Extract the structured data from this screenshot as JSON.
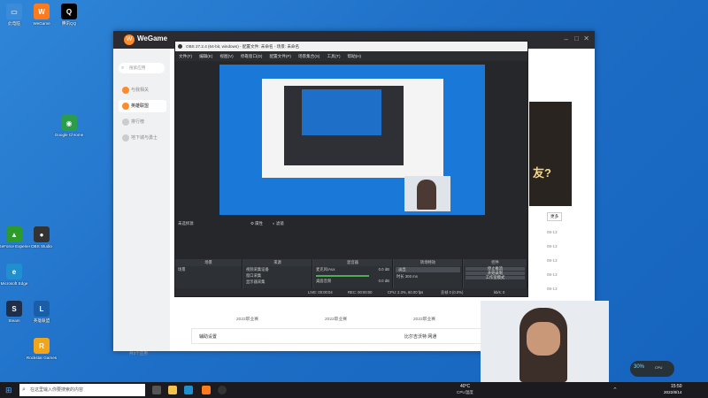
{
  "desktop": {
    "icons": [
      {
        "label": "此电脑",
        "color": "#3b8bd8",
        "glyph": "▭"
      },
      {
        "label": "WeGame",
        "color": "#ff7a1a",
        "glyph": "W"
      },
      {
        "label": "腾讯QQ",
        "color": "#000000",
        "glyph": "Q"
      },
      {
        "label": "Google Chrome",
        "color": "#2a9d4b",
        "glyph": "◉"
      },
      {
        "label": "GeForce Experience",
        "color": "#2c9b2c",
        "glyph": "▲"
      },
      {
        "label": "Microsoft Edge",
        "color": "#1f8fd0",
        "glyph": "e"
      },
      {
        "label": "Steam",
        "color": "#1f2f4a",
        "glyph": "S"
      },
      {
        "label": "英雄联盟",
        "color": "#1a5ea8",
        "glyph": "L"
      },
      {
        "label": "OBS Studio",
        "color": "#333333",
        "glyph": "●"
      },
      {
        "label": "Rockstar Games",
        "color": "#f2a51a",
        "glyph": "R"
      }
    ]
  },
  "wegame": {
    "brand": "WeGame",
    "search_placeholder": "搜索应用",
    "nav": [
      "与我相关",
      "英雄联盟",
      "排行榜",
      "地下城与勇士"
    ],
    "dates": [
      "08-13",
      "08-13",
      "08-13",
      "08-13",
      "08-13"
    ],
    "more": "更多",
    "promo": "友?",
    "bottom_link": "辅助设置",
    "bottom_right": "比尔吉沃特 网通",
    "footer": "共3个应用",
    "match_items": [
      "2022职业赛",
      "2022职业赛",
      "2022职业赛"
    ]
  },
  "obs": {
    "title": "OBS 27.2.4 (64-bit, windows) - 配置文件: 未命名 - 场景: 未命名",
    "menu": [
      "文件(F)",
      "编辑(E)",
      "视图(V)",
      "停靠窗口(D)",
      "配置文件(P)",
      "场景集合(S)",
      "工具(T)",
      "帮助(H)"
    ],
    "scene_label": "未选择源",
    "props_btn": "属性",
    "filters_btn": "滤镜",
    "docks": {
      "scenes": {
        "title": "场景",
        "items": [
          "场景"
        ]
      },
      "sources": {
        "title": "来源",
        "items": [
          "视频采集设备",
          "窗口采集",
          "显示器采集"
        ]
      },
      "mixer": {
        "title": "混音器",
        "channels": [
          "麦克风/Aux",
          "桌面音频"
        ],
        "level": "0.0 dB"
      },
      "transitions": {
        "title": "转场特效",
        "type": "淡出",
        "duration_label": "时长",
        "duration": "300 ms"
      },
      "controls": {
        "title": "控件",
        "buttons": [
          "停止推流",
          "开始录制",
          "工作室模式",
          "设置",
          "退出"
        ]
      }
    },
    "status": {
      "live": "LIVE: 00:00:04",
      "rec": "REC: 00:00:00",
      "cpu": "CPU: 2.3%, 60.00 fps",
      "dropped": "丢帧 0 (0.0%)",
      "kbps": "kb/s: 0"
    }
  },
  "system": {
    "search": "在这里输入你要搜索的内容",
    "temp": "40°C",
    "temp_label": "CPU温度",
    "time": "15:50",
    "date": "2022/8/14",
    "cpu_widget": "30%",
    "cpu_widget_label": "CPU"
  }
}
